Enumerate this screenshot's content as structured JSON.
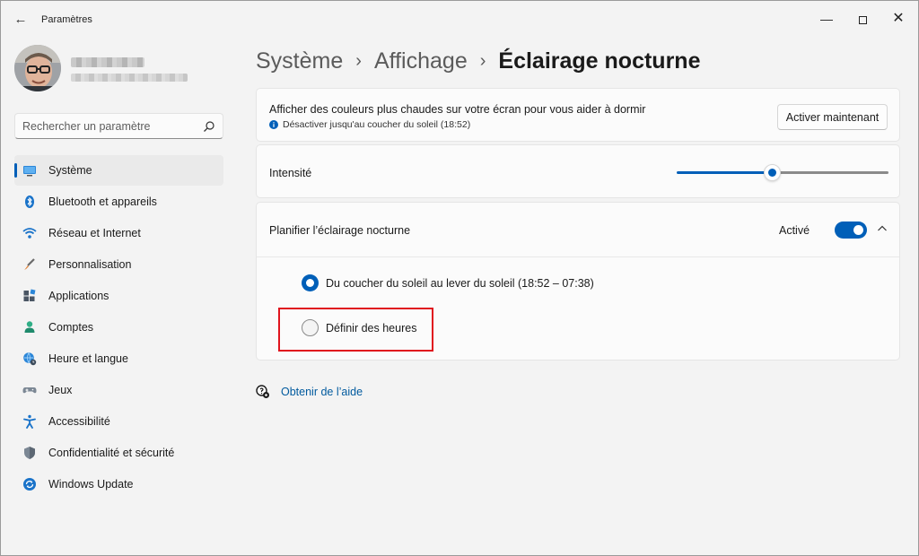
{
  "window": {
    "title": "Paramètres"
  },
  "search": {
    "placeholder": "Rechercher un paramètre"
  },
  "sidebar": {
    "items": [
      {
        "label": "Système",
        "icon": "system-icon",
        "selected": true
      },
      {
        "label": "Bluetooth et appareils",
        "icon": "bluetooth-icon"
      },
      {
        "label": "Réseau et Internet",
        "icon": "wifi-icon"
      },
      {
        "label": "Personnalisation",
        "icon": "brush-icon"
      },
      {
        "label": "Applications",
        "icon": "apps-icon"
      },
      {
        "label": "Comptes",
        "icon": "person-icon"
      },
      {
        "label": "Heure et langue",
        "icon": "globe-clock-icon"
      },
      {
        "label": "Jeux",
        "icon": "gamepad-icon"
      },
      {
        "label": "Accessibilité",
        "icon": "accessibility-icon"
      },
      {
        "label": "Confidentialité et sécurité",
        "icon": "shield-icon"
      },
      {
        "label": "Windows Update",
        "icon": "update-icon"
      }
    ]
  },
  "breadcrumb": {
    "level1": "Système",
    "level2": "Affichage",
    "current": "Éclairage nocturne"
  },
  "night_light": {
    "description": "Afficher des couleurs plus chaudes sur votre écran pour vous aider à dormir",
    "status": "Désactiver jusqu'au coucher du soleil (18:52)",
    "button_label": "Activer maintenant"
  },
  "intensity": {
    "label": "Intensité",
    "value_percent": 45
  },
  "schedule": {
    "title": "Planifier l’éclairage nocturne",
    "toggle_label": "Activé",
    "toggle_on": true,
    "option_sunset": "Du coucher du soleil au lever du soleil (18:52 – 07:38)",
    "option_hours": "Définir des heures",
    "selected_option": "sunset"
  },
  "help": {
    "label": "Obtenir de l’aide"
  },
  "colors": {
    "accent": "#005fb8",
    "highlight": "#e0141e",
    "link": "#005a9e"
  }
}
